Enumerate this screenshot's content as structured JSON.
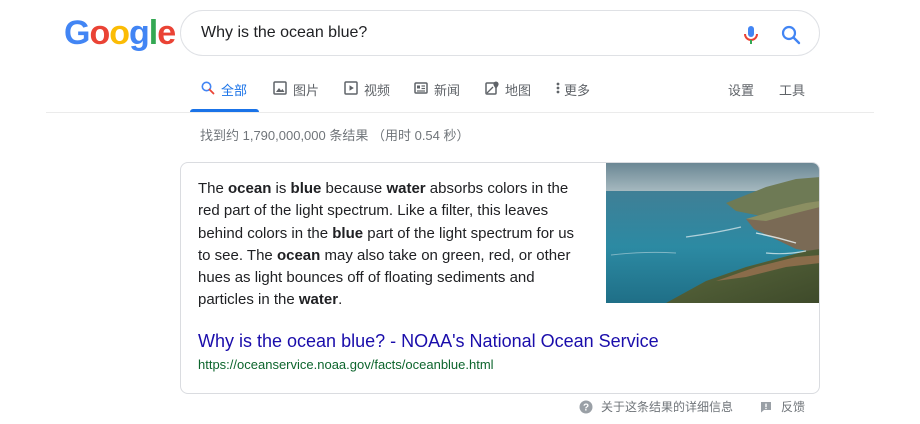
{
  "logo": {
    "letters": [
      "G",
      "o",
      "o",
      "g",
      "l",
      "e"
    ],
    "colors": [
      "#4285f4",
      "#ea4335",
      "#fbbc05",
      "#4285f4",
      "#34a853",
      "#ea4335"
    ]
  },
  "search": {
    "query": "Why is the ocean blue?"
  },
  "tabs": [
    {
      "label": "全部",
      "icon": "search-icon",
      "active": true
    },
    {
      "label": "图片",
      "icon": "image-icon"
    },
    {
      "label": "视频",
      "icon": "video-icon"
    },
    {
      "label": "新闻",
      "icon": "news-icon"
    },
    {
      "label": "地图",
      "icon": "map-icon"
    },
    {
      "label": "更多",
      "icon": "more-vert-icon"
    }
  ],
  "tools": {
    "settings": "设置",
    "tools": "工具"
  },
  "stats": "找到约 1,790,000,000 条结果 （用时 0.54 秒）",
  "snippet": {
    "parts": [
      {
        "t": "The ",
        "b": false
      },
      {
        "t": "ocean",
        "b": true
      },
      {
        "t": " is ",
        "b": false
      },
      {
        "t": "blue",
        "b": true
      },
      {
        "t": " because ",
        "b": false
      },
      {
        "t": "water",
        "b": true
      },
      {
        "t": " absorbs colors in the red part of the light spectrum. Like a filter, this leaves behind colors in the ",
        "b": false
      },
      {
        "t": "blue",
        "b": true
      },
      {
        "t": " part of the light spectrum for us to see. The ",
        "b": false
      },
      {
        "t": "ocean",
        "b": true
      },
      {
        "t": " may also take on green, red, or other hues as light bounces off of floating sediments and particles in the ",
        "b": false
      },
      {
        "t": "water",
        "b": true
      },
      {
        "t": ".",
        "b": false
      }
    ],
    "title": "Why is the ocean blue? - NOAA's National Ocean Service",
    "url": "https://oceanservice.noaa.gov/facts/oceanblue.html",
    "image": "ocean-coastline-photo"
  },
  "footer": {
    "about": "关于这条结果的详细信息",
    "feedback": "反馈"
  },
  "colors": {
    "accent": "#1a73e8",
    "link": "#1a0dab",
    "url": "#0d652d"
  }
}
